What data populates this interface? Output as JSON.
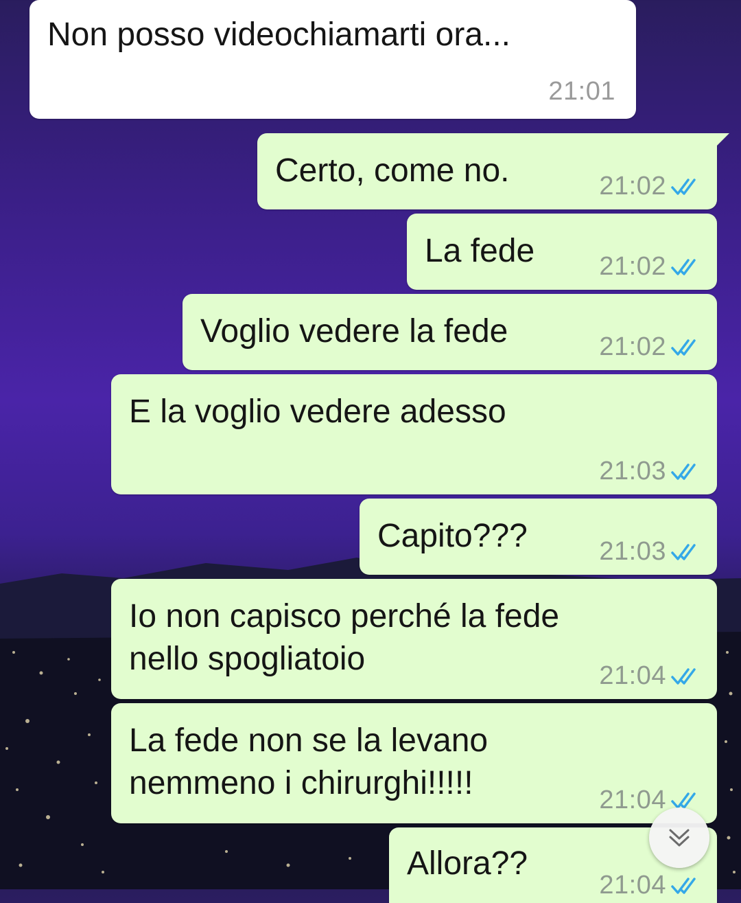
{
  "messages": [
    {
      "text": "Non posso videochiamarti ora...",
      "time": "21:01",
      "direction": "incoming"
    },
    {
      "text": "Certo, come no.",
      "time": "21:02",
      "direction": "outgoing",
      "status": "read"
    },
    {
      "text": "La fede",
      "time": "21:02",
      "direction": "outgoing",
      "status": "read"
    },
    {
      "text": "Voglio vedere la fede",
      "time": "21:02",
      "direction": "outgoing",
      "status": "read"
    },
    {
      "text": "E la voglio vedere adesso",
      "time": "21:03",
      "direction": "outgoing",
      "status": "read"
    },
    {
      "text": "Capito???",
      "time": "21:03",
      "direction": "outgoing",
      "status": "read"
    },
    {
      "text": "Io non capisco perché la fede\nnello spogliatoio",
      "time": "21:04",
      "direction": "outgoing",
      "status": "read"
    },
    {
      "text": "La fede non se la levano\nnemmeno i chirurghi!!!!!",
      "time": "21:04",
      "direction": "outgoing",
      "status": "read"
    },
    {
      "text": "Allora??",
      "time": "21:04",
      "direction": "outgoing",
      "status": "read"
    }
  ],
  "icons": {
    "read_receipt": "double-check-icon",
    "scroll_down": "chevron-double-down-icon"
  },
  "colors": {
    "incoming_bubble": "#ffffff",
    "outgoing_bubble": "#e2fdcf",
    "read_tick": "#34a8e8",
    "timestamp": "#8f9a8f"
  }
}
